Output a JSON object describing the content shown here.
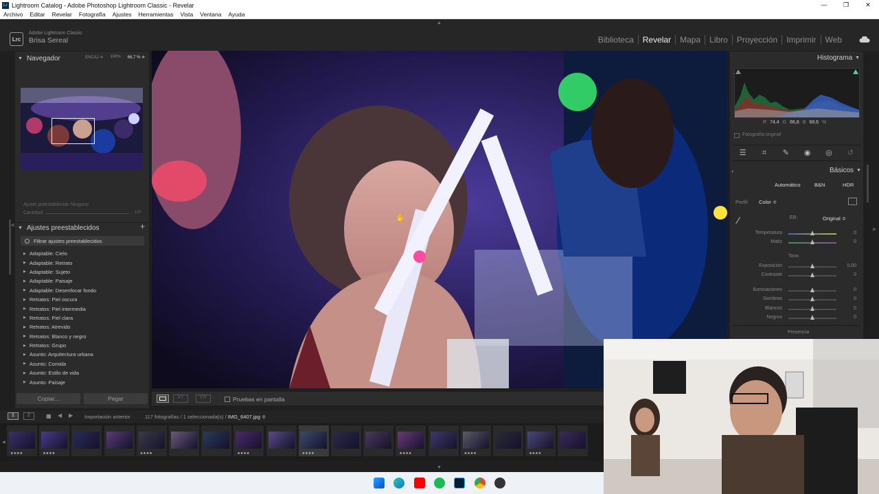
{
  "window": {
    "title": "Lightroom Catalog - Adobe Photoshop Lightroom Classic - Revelar"
  },
  "menu": [
    "Archivo",
    "Editar",
    "Revelar",
    "Fotografía",
    "Ajustes",
    "Herramientas",
    "Vista",
    "Ventana",
    "Ayuda"
  ],
  "identity": {
    "logo": "Lrc",
    "product": "Adobe Lightroom Classic",
    "user": "Brisa Sereal"
  },
  "modules": [
    {
      "label": "Biblioteca",
      "active": false
    },
    {
      "label": "Revelar",
      "active": true
    },
    {
      "label": "Mapa",
      "active": false
    },
    {
      "label": "Libro",
      "active": false
    },
    {
      "label": "Proyección",
      "active": false
    },
    {
      "label": "Imprimir",
      "active": false
    },
    {
      "label": "Web",
      "active": false
    }
  ],
  "navigator": {
    "title": "Navegador",
    "zoom_options": [
      "ENCAJ ≑",
      "100%",
      "66,7 % ≑"
    ],
    "zoom_selected_index": 2
  },
  "preset_amount": {
    "preset_label": "Ajuste preestablecido Ninguno",
    "amount_label": "Cantidad",
    "amount_value": "100"
  },
  "presets": {
    "title": "Ajustes preestablecidos",
    "add_symbol": "+",
    "filter_placeholder": "Filtrar ajustes preestablecidos",
    "items": [
      "Adaptable: Cielo",
      "Adaptable: Retrato",
      "Adaptable: Sujeto",
      "Adaptable: Paisaje",
      "Adaptable: Desenfocar fondo",
      "Retratos: Piel oscura",
      "Retratos: Piel intermedia",
      "Retratos: Piel clara",
      "Retratos: Atrevido",
      "Retratos: Blanco y negro",
      "Retratos: Grupo",
      "Asunto: Arquitectura urbana",
      "Asunto: Comida",
      "Asunto: Estilo de vida",
      "Asunto: Paisaje"
    ]
  },
  "buttons": {
    "copy": "Copiar...",
    "paste": "Pegar"
  },
  "toolbar": {
    "compare": "XY",
    "survey": "Y|Y",
    "soft_proof": "Pruebas en pantalla"
  },
  "histogram": {
    "title": "Histograma",
    "readout": {
      "r_label": "R",
      "r": "74,4",
      "g_label": "G",
      "g": "66,8",
      "b_label": "B",
      "b": "68,6",
      "unit": "%"
    },
    "original_photo": "Fotografía original"
  },
  "basic": {
    "title": "Básicos",
    "auto": "Automático",
    "bw": "B&N",
    "hdr": "HDR",
    "profile_label": "Perfil:",
    "profile_value": "Color ≑",
    "wb_label": "EB:",
    "wb_value": "Original ≑",
    "tone_label": "Tono",
    "presence_label": "Presencia",
    "sliders": [
      {
        "label": "Temperatura",
        "value": "0",
        "pos": 0.5
      },
      {
        "label": "Matiz",
        "value": "0",
        "pos": 0.5
      },
      {
        "label": "Exposición",
        "value": "0,00",
        "pos": 0.5
      },
      {
        "label": "Contraste",
        "value": "0",
        "pos": 0.5
      },
      {
        "label": "Iluminaciones",
        "value": "0",
        "pos": 0.5
      },
      {
        "label": "Sombras",
        "value": "0",
        "pos": 0.5
      },
      {
        "label": "Blancos",
        "value": "0",
        "pos": 0.5
      },
      {
        "label": "Negros",
        "value": "0",
        "pos": 0.5
      }
    ]
  },
  "filmstrip": {
    "view1": "1",
    "view2": "2",
    "source": "Importación anterior",
    "count": "117 fotografías / 1 seleccionada(s) /",
    "filename": "IMG_6407.jpg ≑",
    "thumb_stars": "★★★★"
  },
  "colors": {
    "accent": "#f0f0f0",
    "panel": "#2b2b2b",
    "background": "#1f1f1f"
  }
}
